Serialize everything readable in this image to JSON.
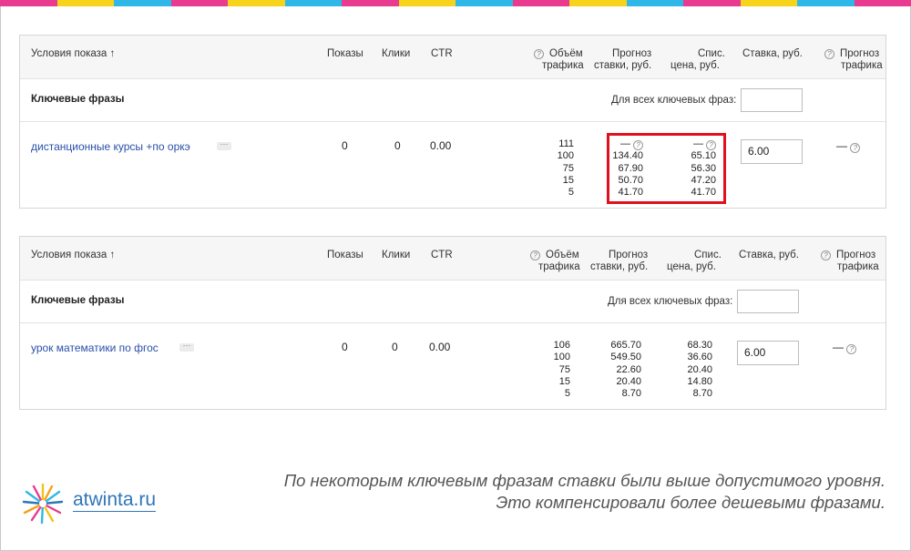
{
  "colors": {
    "stripe": [
      "#e83a8f",
      "#f7d31b",
      "#2fb8e7",
      "#e83a8f",
      "#f7d31b",
      "#2fb8e7",
      "#e83a8f",
      "#f7d31b",
      "#2fb8e7",
      "#e83a8f",
      "#f7d31b",
      "#2fb8e7",
      "#e83a8f",
      "#f7d31b",
      "#2fb8e7",
      "#e83a8f"
    ],
    "link": "#2a4fa8",
    "highlight": "#e0101e",
    "brand": "#2e76b9"
  },
  "table_header": {
    "conditions": "Условия показа ↑",
    "impressions": "Показы",
    "clicks": "Клики",
    "ctr": "CTR",
    "traffic_volume_1": "Объём",
    "traffic_volume_2": "трафика",
    "bid_forecast_1": "Прогноз",
    "bid_forecast_2": "ставки, руб.",
    "charged_price_1": "Спис.",
    "charged_price_2": "цена, руб.",
    "bid": "Ставка, руб.",
    "traffic_forecast_1": "Прогноз",
    "traffic_forecast_2": "трафика",
    "help_icon": "?"
  },
  "keywords_section": {
    "label": "Ключевые фразы",
    "all_phrases_label": "Для всех ключевых фраз:"
  },
  "rows": [
    {
      "phrase": "дистанционные курсы +по оркэ",
      "menu": "···",
      "impressions": "0",
      "clicks": "0",
      "ctr": "0.00",
      "traffic": [
        "111",
        "100",
        "75",
        "15",
        "5"
      ],
      "forecast_bids": [
        "—",
        "134.40",
        "67.90",
        "50.70",
        "41.70"
      ],
      "charged_prices": [
        "—",
        "65.10",
        "56.30",
        "47.20",
        "41.70"
      ],
      "bid": "6.00",
      "traffic_forecast": "—"
    },
    {
      "phrase": "урок математики по фгос",
      "menu": "···",
      "impressions": "0",
      "clicks": "0",
      "ctr": "0.00",
      "traffic": [
        "106",
        "100",
        "75",
        "15",
        "5"
      ],
      "forecast_bids": [
        "665.70",
        "549.50",
        "22.60",
        "20.40",
        "8.70"
      ],
      "charged_prices": [
        "68.30",
        "36.60",
        "20.40",
        "14.80",
        "8.70"
      ],
      "bid": "6.00",
      "traffic_forecast": "—"
    }
  ],
  "brand": {
    "name": "atwinta.ru"
  },
  "caption": {
    "line1": "По некоторым ключевым фразам ставки были  выше допустимого уровня.",
    "line2": "Это компенсировали более дешевыми фразами."
  }
}
